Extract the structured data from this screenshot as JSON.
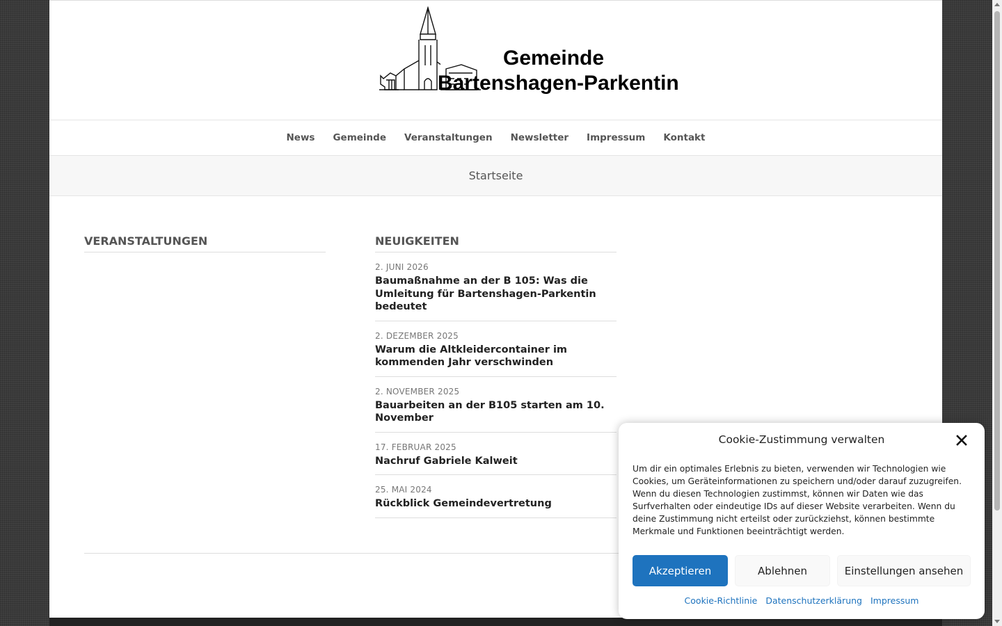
{
  "header": {
    "logo_line1": "Gemeinde",
    "logo_line2": "Bartenshagen-Parkentin"
  },
  "nav": {
    "items": [
      "News",
      "Gemeinde",
      "Veranstaltungen",
      "Newsletter",
      "Impressum",
      "Kontakt"
    ]
  },
  "breadcrumb": {
    "current": "Startseite"
  },
  "events_widget": {
    "title": "VERANSTALTUNGEN"
  },
  "news_widget": {
    "title": "NEUIGKEITEN",
    "items": [
      {
        "date": "2. JUNI 2026",
        "title": "Baumaßnahme an der B 105: Was die Umleitung für Bartenshagen-Parkentin bedeutet"
      },
      {
        "date": "2. DEZEMBER 2025",
        "title": "Warum die Altkleidercontainer im kommenden Jahr verschwinden"
      },
      {
        "date": "2. NOVEMBER 2025",
        "title": "Bauarbeiten an der B105 starten am 10. November"
      },
      {
        "date": "17. FEBRUAR 2025",
        "title": "Nachruf Gabriele Kalweit"
      },
      {
        "date": "25. MAI 2024",
        "title": "Rückblick Gemeindevertretung"
      }
    ]
  },
  "cookie": {
    "title": "Cookie-Zustimmung verwalten",
    "text": "Um dir ein optimales Erlebnis zu bieten, verwenden wir Technologien wie Cookies, um Geräteinformationen zu speichern und/oder darauf zuzugreifen. Wenn du diesen Technologien zustimmst, können wir Daten wie das Surfverhalten oder eindeutige IDs auf dieser Website verarbeiten. Wenn du deine Zustimmung nicht erteilst oder zurückziehst, können bestimmte Merkmale und Funktionen beeinträchtigt werden.",
    "accept_label": "Akzeptieren",
    "deny_label": "Ablehnen",
    "settings_label": "Einstellungen ansehen",
    "links": [
      "Cookie-Richtlinie",
      "Datenschutzerklärung",
      "Impressum"
    ],
    "accent_color": "#1e73be"
  }
}
